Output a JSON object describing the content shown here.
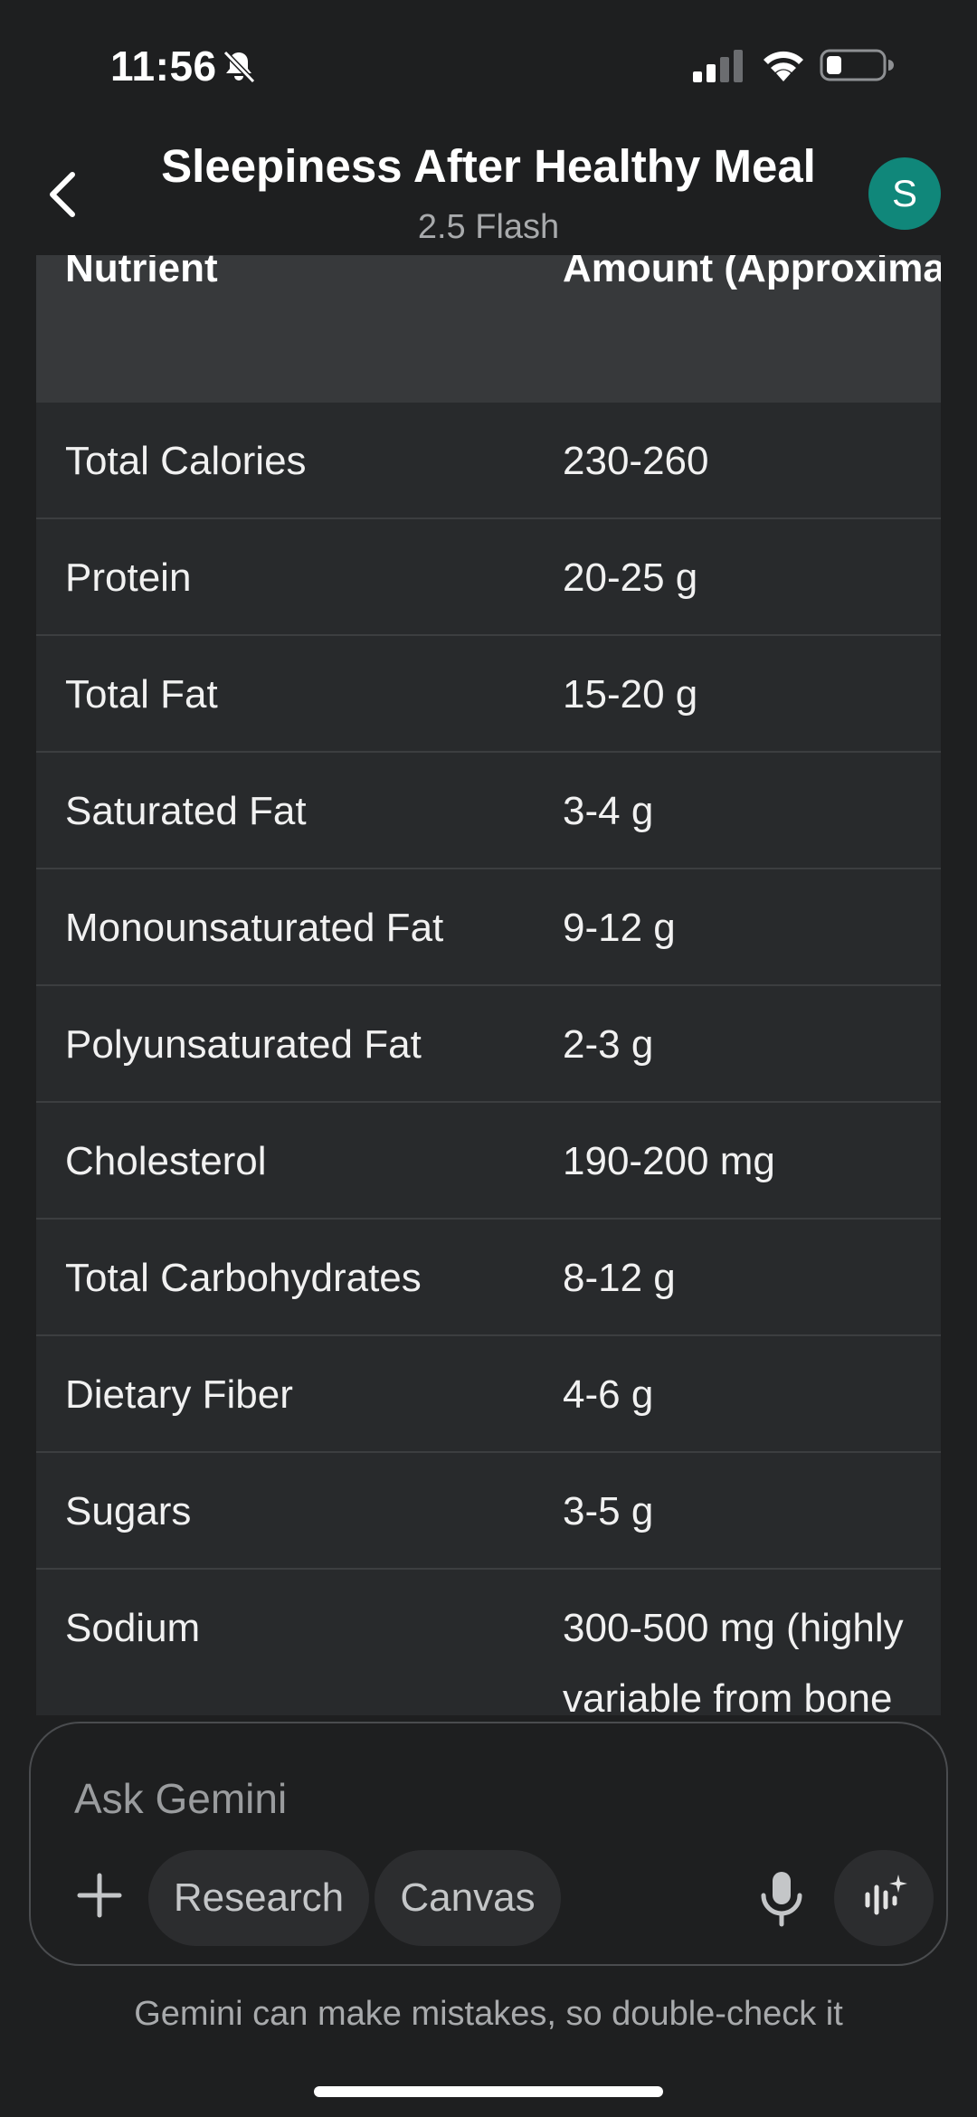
{
  "status_bar": {
    "time": "11:56"
  },
  "header": {
    "title": "Sleepiness After Healthy Meal",
    "subtitle": "2.5 Flash",
    "avatar_letter": "S"
  },
  "table": {
    "headers": [
      "Nutrient",
      "Amount (Approximat"
    ],
    "rows": [
      {
        "nutrient": "Total Calories",
        "amount": "230-260"
      },
      {
        "nutrient": "Protein",
        "amount": "20-25 g"
      },
      {
        "nutrient": "Total Fat",
        "amount": "15-20 g"
      },
      {
        "nutrient": "Saturated Fat",
        "amount": "3-4 g"
      },
      {
        "nutrient": "Monounsaturated Fat",
        "amount": "9-12 g"
      },
      {
        "nutrient": "Polyunsaturated Fat",
        "amount": "2-3 g"
      },
      {
        "nutrient": "Cholesterol",
        "amount": "190-200 mg"
      },
      {
        "nutrient": "Total Carbohydrates",
        "amount": "8-12 g"
      },
      {
        "nutrient": "Dietary Fiber",
        "amount": "4-6 g"
      },
      {
        "nutrient": "Sugars",
        "amount": "3-5 g"
      },
      {
        "nutrient": "Sodium",
        "amount": "300-500 mg (highly",
        "amount_line2": "variable from bone"
      }
    ]
  },
  "composer": {
    "placeholder": "Ask Gemini",
    "chips": [
      "Research",
      "Canvas"
    ]
  },
  "disclaimer": "Gemini can make mistakes, so double-check it",
  "colors": {
    "avatar": "#10877a",
    "background": "#1e1f20",
    "table_header": "#37393b",
    "table_body": "#282a2c"
  }
}
